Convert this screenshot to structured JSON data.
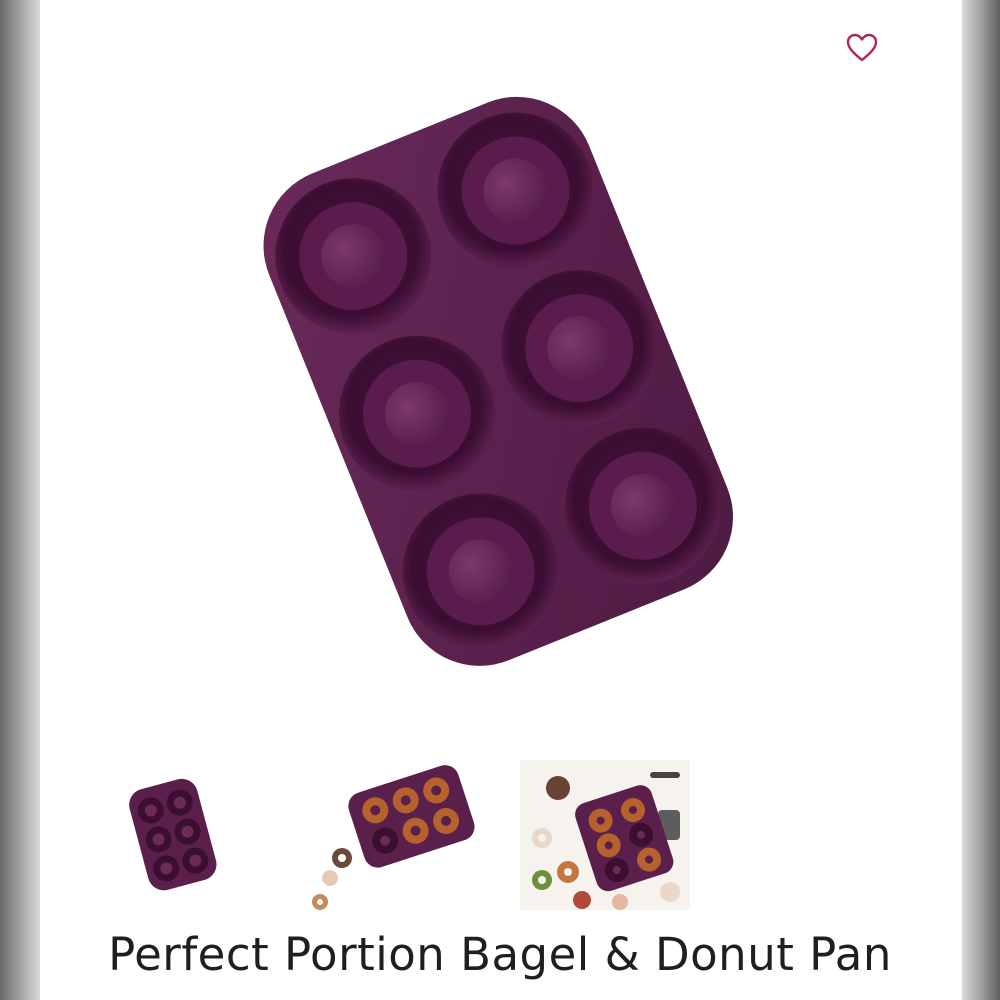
{
  "product": {
    "title": "Perfect Portion Bagel & Donut Pan",
    "main_image": "purple silicone 6-cavity donut pan",
    "thumbnail_count": 3
  },
  "icons": {
    "favorite": "heart-outline-icon"
  },
  "colors": {
    "accent": "#b0245c",
    "pan": "#5a1f4a",
    "pan_dark": "#3c0f30",
    "pan_light": "#7a3466",
    "donut": "#b5622f",
    "title": "#1f1f1f"
  }
}
